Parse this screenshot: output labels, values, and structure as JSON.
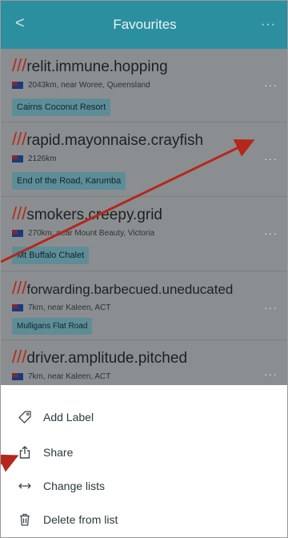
{
  "header": {
    "back_glyph": "<",
    "title": "Favourites",
    "more_glyph": "···"
  },
  "items": [
    {
      "slashes": "///",
      "words": "relit.immune.hopping",
      "meta": "2043km, near Woree, Queensland",
      "label": "Cairns Coconut Resort"
    },
    {
      "slashes": "///",
      "words": "rapid.mayonnaise.crayfish",
      "meta": "2126km",
      "label": "End of the Road, Karumba"
    },
    {
      "slashes": "///",
      "words": "smokers.creepy.grid",
      "meta": "270km, near Mount Beauty, Victoria",
      "label": "Mt Buffalo Chalet"
    },
    {
      "slashes": "///",
      "words": "forwarding.barbecued.uneducated",
      "meta": "7km, near Kaleen, ACT",
      "label": "Mulligans Flat Road"
    },
    {
      "slashes": "///",
      "words": "driver.amplitude.pitched",
      "meta": "7km, near Kaleen, ACT",
      "label": ""
    }
  ],
  "item_more_glyph": "···",
  "sheet": {
    "items": [
      {
        "label": "Add Label",
        "icon": "tag-icon"
      },
      {
        "label": "Share",
        "icon": "share-icon"
      },
      {
        "label": "Change lists",
        "icon": "swap-arrows-icon"
      },
      {
        "label": "Delete from list",
        "icon": "trash-icon"
      }
    ]
  },
  "colors": {
    "header": "#2c8fa0",
    "slashes": "#b5271c",
    "label_bg": "#5e8d97",
    "overlay": "#8b8e90",
    "annotation_arrow": "#b5271c"
  }
}
